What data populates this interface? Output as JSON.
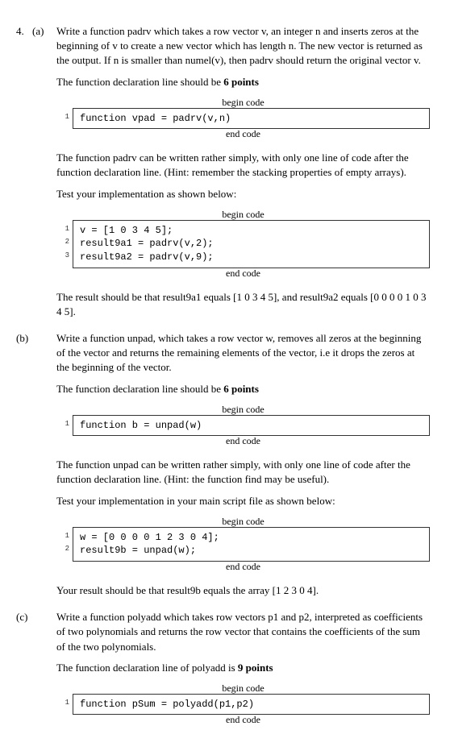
{
  "q_num": "4.",
  "labels": {
    "begin": "begin code",
    "end": "end code"
  },
  "a": {
    "sub": "(a)",
    "p1": "Write a function padrv which takes a row vector v, an integer n and inserts zeros at the beginning of v to create a new vector which has length n. The new vector is returned as the output. If n is smaller than numel(v), then padrv should return the original vector v.",
    "p2_pre": "The function declaration line should be ",
    "p2_pts": "6 points",
    "code1": "function vpad = padrv(v,n)",
    "p3": "The function padrv can be written rather simply, with only one line of code after the function declaration line. (Hint: remember the stacking properties of empty arrays).",
    "p4": "Test your implementation as shown below:",
    "code2_l1": "v = [1 0 3 4 5];",
    "code2_l2": "result9a1 = padrv(v,2);",
    "code2_l3": "result9a2 = padrv(v,9);",
    "p5": "The result should be that result9a1 equals [1 0 3 4 5], and result9a2 equals [0 0 0 0 1 0 3 4 5]."
  },
  "b": {
    "sub": "(b)",
    "p1": "Write a function unpad, which takes a row vector w, removes all zeros at the beginning of the vector and returns the remaining elements of the vector, i.e it drops the zeros at the beginning of the vector.",
    "p2_pre": "The function declaration line should be ",
    "p2_pts": "6 points",
    "code1": "function b = unpad(w)",
    "p3": "The function unpad can be written rather simply, with only one line of code after the function declaration line. (Hint: the function find may be useful).",
    "p4": "Test your implementation in your main script file as shown below:",
    "code2_l1": "w = [0 0 0 0 1 2 3 0 4];",
    "code2_l2": "result9b = unpad(w);",
    "p5": "Your result should be that result9b equals the array [1 2 3 0 4]."
  },
  "c": {
    "sub": "(c)",
    "p1": "Write a function polyadd which takes row vectors p1 and p2, interpreted as coefficients of two polynomials and returns the row vector that contains the coefficients of the sum of the two polynomials.",
    "p2_pre": "The function declaration line of polyadd is ",
    "p2_pts": "9 points",
    "code1": "function pSum = polyadd(p1,p2)"
  },
  "ln": {
    "1": "1",
    "2": "2",
    "3": "3"
  }
}
